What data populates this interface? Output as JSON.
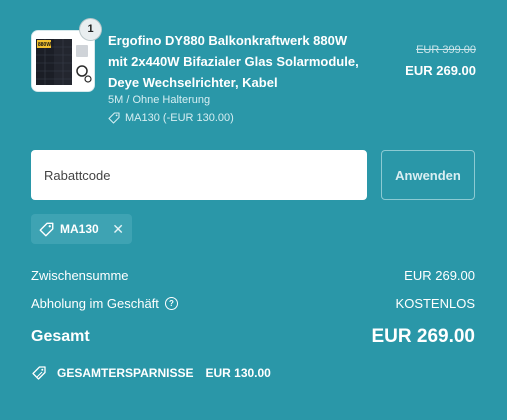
{
  "product": {
    "quantity": "1",
    "title": "Ergofino DY880 Balkonkraftwerk 880W mit 2x440W Bifazialer Glas Solarmodule, Deye Wechselrichter, Kabel",
    "variant": "5M / Ohne Halterung",
    "discount": "MA130 (-EUR 130.00)",
    "price_original": "EUR 399.00",
    "price_current": "EUR 269.00",
    "thumb_badge": "880W"
  },
  "coupon": {
    "placeholder": "Rabattcode",
    "apply_label": "Anwenden",
    "applied_code": "MA130",
    "remove_symbol": "✕"
  },
  "summary": {
    "subtotal_label": "Zwischensumme",
    "subtotal_value": "EUR 269.00",
    "shipping_label": "Abholung im Geschäft",
    "shipping_info": "?",
    "shipping_value": "KOSTENLOS",
    "total_label": "Gesamt",
    "total_value": "EUR 269.00",
    "savings_label": "GESAMTERSPARNISSE",
    "savings_value": "EUR 130.00"
  },
  "colors": {
    "background": "#2a97a8",
    "chip": "#3ea3b3"
  }
}
